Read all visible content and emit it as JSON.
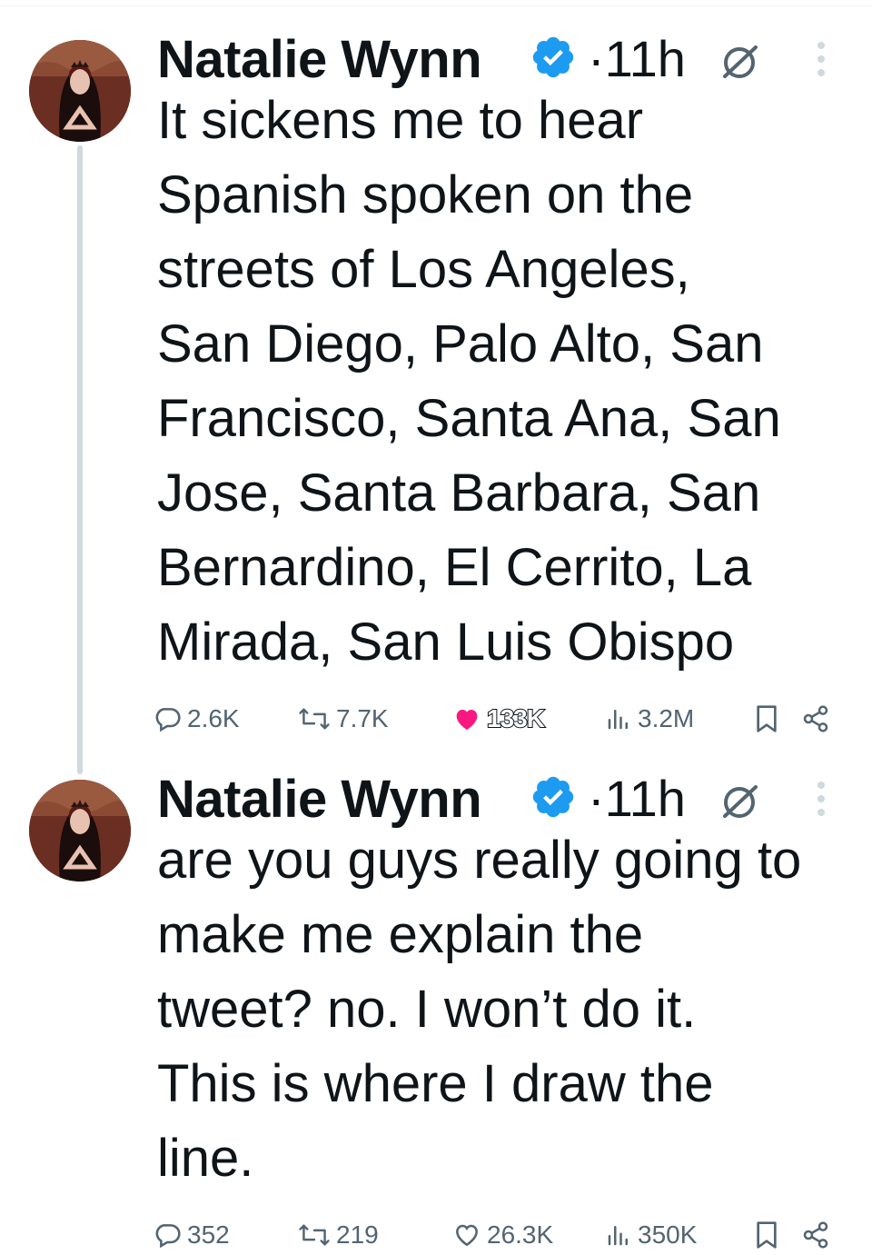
{
  "thread": {
    "tweets": [
      {
        "author": "Natalie Wynn",
        "separator": "·",
        "time": "11h",
        "text": "It sickens me to hear\nSpanish spoken on the\nstreets of Los Angeles,\nSan Diego, Palo Alto, San\nFrancisco, Santa Ana, San\nJose, Santa Barbara, San\nBernardino, El Cerrito, La\nMirada, San Luis Obispo",
        "stats": {
          "replies": "2.6K",
          "retweets": "7.7K",
          "likes": "133K",
          "views": "3.2M"
        },
        "liked": true
      },
      {
        "author": "Natalie Wynn",
        "separator": "·",
        "time": "11h",
        "text": "are you guys really going to\nmake me explain the\ntweet? no. I won’t do it.\nThis is where I draw the\nline.",
        "stats": {
          "replies": "352",
          "retweets": "219",
          "likes": "26.3K",
          "views": "350K"
        },
        "liked": false
      }
    ]
  },
  "icons": {
    "verified": "verified-badge-icon",
    "edited": "edited-icon",
    "more": "more-options-icon",
    "reply": "reply-icon",
    "retweet": "retweet-icon",
    "like": "heart-icon",
    "views": "views-icon",
    "bookmark": "bookmark-icon",
    "share": "share-icon"
  },
  "colors": {
    "text": "#0f1419",
    "secondary": "#536471",
    "verified": "#1d9bf0",
    "like": "#f91880",
    "thread_line": "#cfd9de"
  }
}
